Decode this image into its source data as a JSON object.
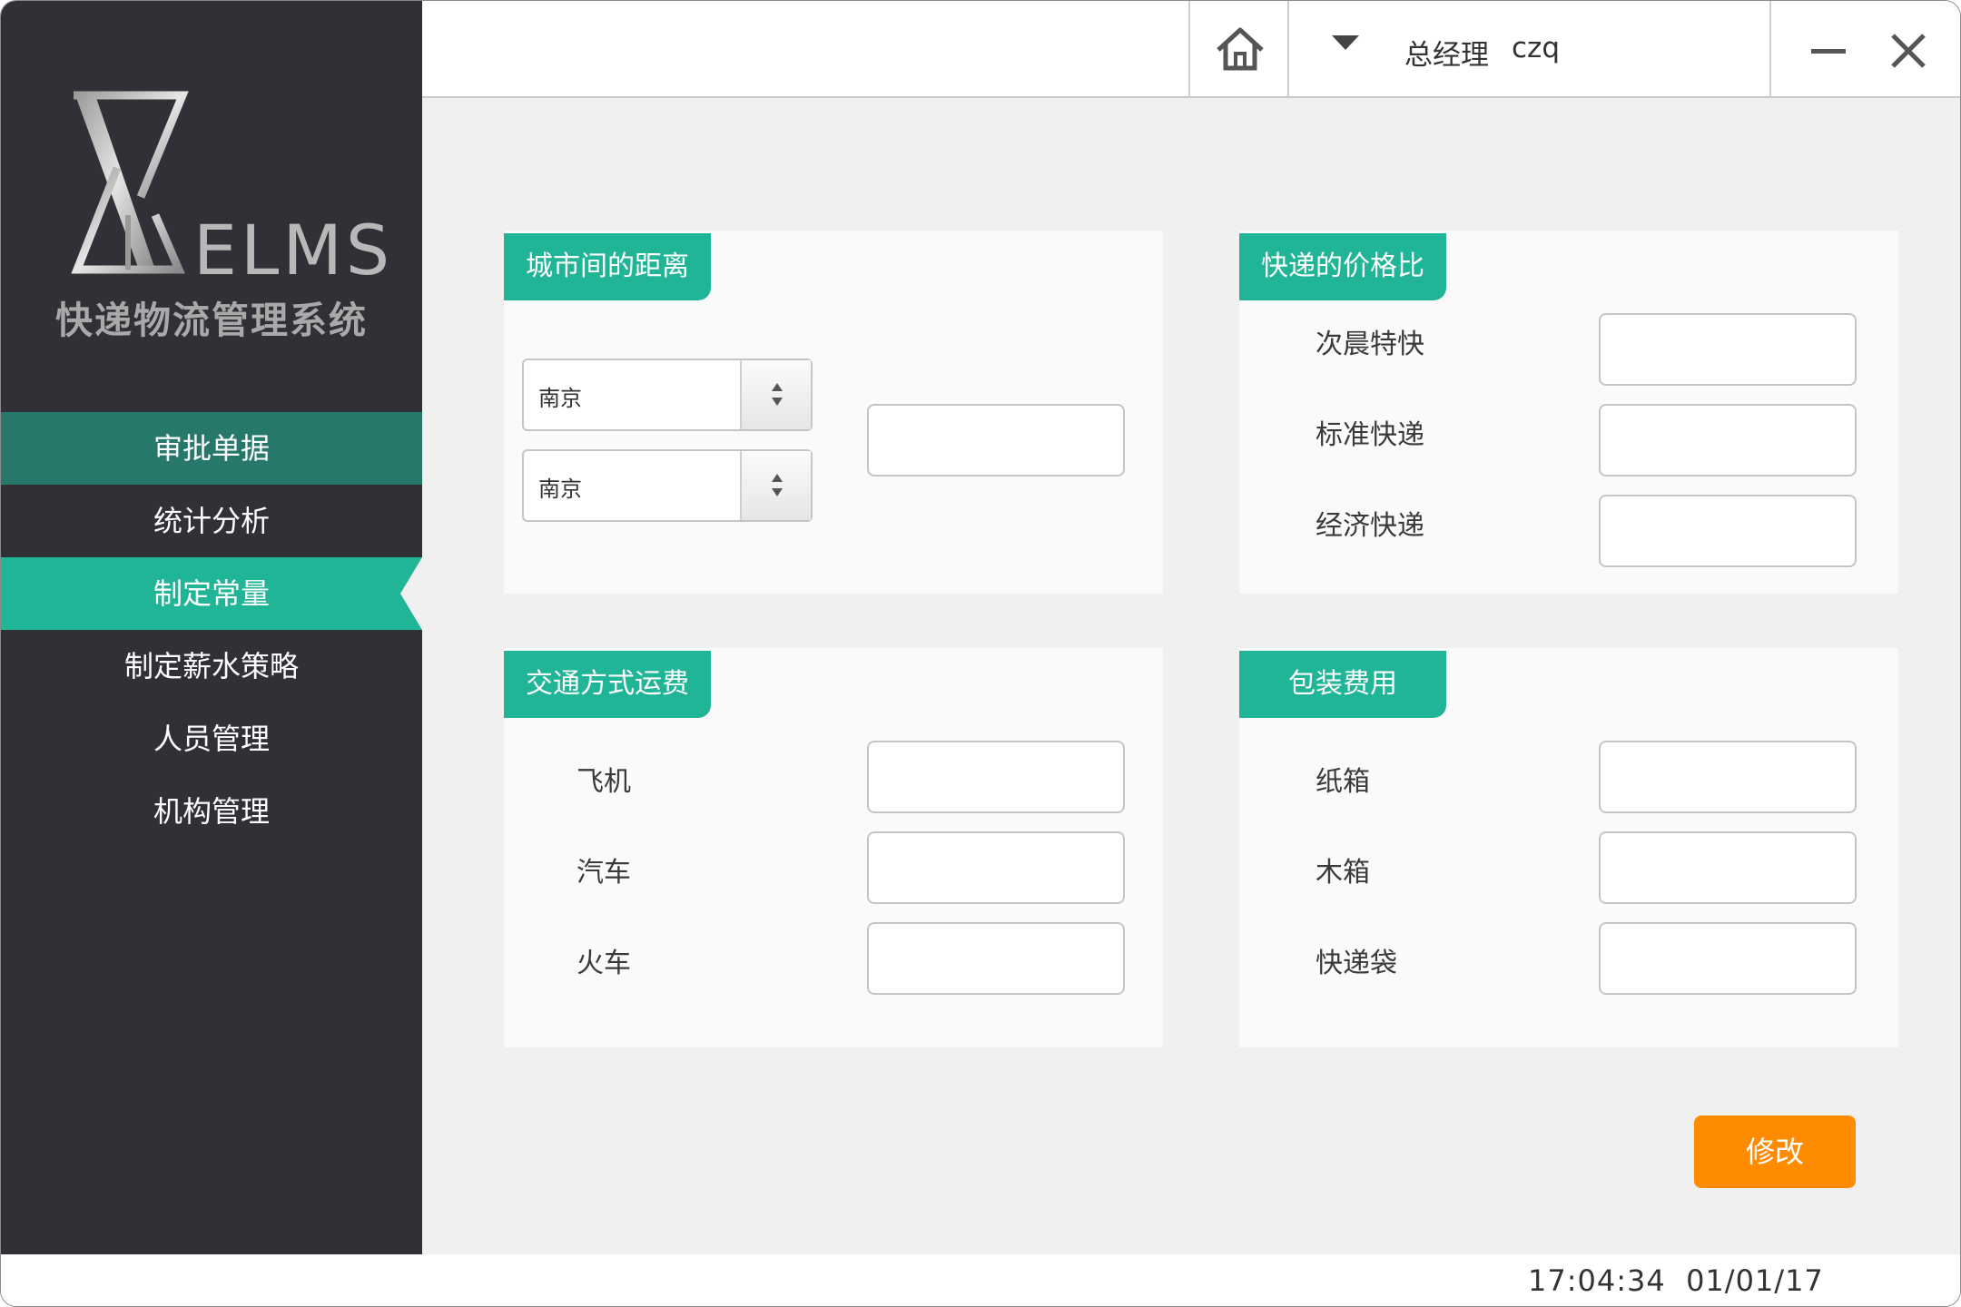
{
  "app": {
    "logo_word": "ELMS",
    "logo_subtitle": "快递物流管理系统",
    "accent_color": "#21b597",
    "sidebar_color": "#2f3136",
    "button_color": "#ff8c00"
  },
  "header": {
    "home_icon": "home-icon",
    "user_role": "总经理",
    "user_name": "czq"
  },
  "sidebar": {
    "items": [
      {
        "label": "审批单据",
        "state": "hover"
      },
      {
        "label": "统计分析",
        "state": "normal"
      },
      {
        "label": "制定常量",
        "state": "active"
      },
      {
        "label": "制定薪水策略",
        "state": "normal"
      },
      {
        "label": "人员管理",
        "state": "normal"
      },
      {
        "label": "机构管理",
        "state": "normal"
      }
    ]
  },
  "panels": {
    "distance": {
      "title": "城市间的距离",
      "from_city": "南京",
      "to_city": "南京",
      "distance_value": ""
    },
    "price_ratio": {
      "title": "快递的价格比",
      "fields": [
        {
          "label": "次晨特快",
          "value": ""
        },
        {
          "label": "标准快递",
          "value": ""
        },
        {
          "label": "经济快递",
          "value": ""
        }
      ]
    },
    "transport": {
      "title": "交通方式运费",
      "fields": [
        {
          "label": "飞机",
          "value": ""
        },
        {
          "label": "汽车",
          "value": ""
        },
        {
          "label": "火车",
          "value": ""
        }
      ]
    },
    "packaging": {
      "title": "包装费用",
      "fields": [
        {
          "label": "纸箱",
          "value": ""
        },
        {
          "label": "木箱",
          "value": ""
        },
        {
          "label": "快递袋",
          "value": ""
        }
      ]
    }
  },
  "actions": {
    "modify_label": "修改"
  },
  "footer": {
    "time": "17:04:34",
    "date": "01/01/17"
  }
}
